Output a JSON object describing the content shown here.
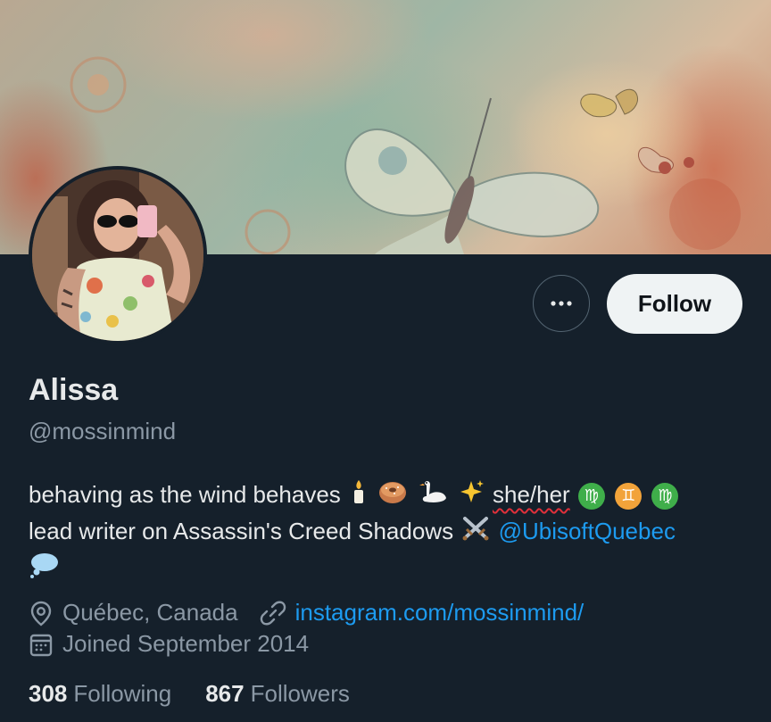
{
  "profile": {
    "name": "Alissa",
    "handle": "@mossinmind",
    "bio_line1_text": "behaving as the wind behaves",
    "bio_pronouns": "she/her",
    "bio_line2_text": "lead writer on Assassin's Creed Shadows",
    "bio_mention": "@UbisoftQuebec",
    "location": "Québec, Canada",
    "website": "instagram.com/mossinmind/",
    "joined": "Joined September 2014"
  },
  "actions": {
    "follow_label": "Follow",
    "more_icon": "more-horizontal-icon"
  },
  "stats": {
    "following_count": "308",
    "following_label": "Following",
    "followers_count": "867",
    "followers_label": "Followers"
  },
  "bio_emojis": [
    "candle",
    "bagel",
    "swan",
    "sparkles",
    "virgo",
    "gemini",
    "virgo",
    "crossed-swords",
    "thought-balloon"
  ],
  "colors": {
    "background": "#15202b",
    "text_primary": "#e7e9ea",
    "text_secondary": "#8b98a5",
    "link": "#1d9bf0",
    "follow_button_bg": "#eff3f4"
  }
}
